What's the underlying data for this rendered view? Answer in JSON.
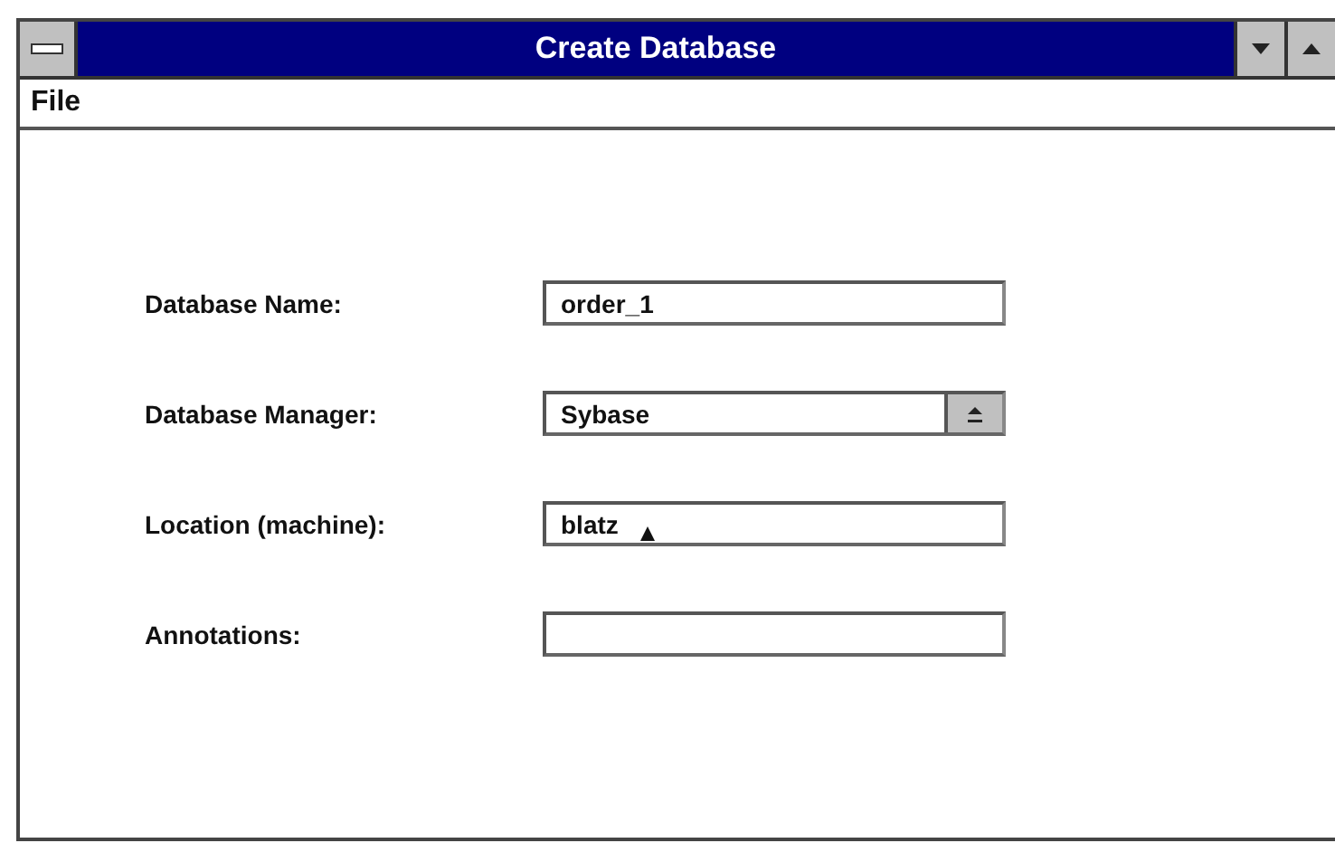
{
  "window": {
    "title": "Create Database"
  },
  "menu": [
    "File"
  ],
  "fields": [
    {
      "label": "Database Name:",
      "kind": "text",
      "value": "order_1"
    },
    {
      "label": "Database Manager:",
      "kind": "dropdown",
      "value": "Sybase"
    },
    {
      "label": "Location (machine):",
      "kind": "text",
      "value": "blatz"
    },
    {
      "label": "Annotations:",
      "kind": "text"
    }
  ]
}
